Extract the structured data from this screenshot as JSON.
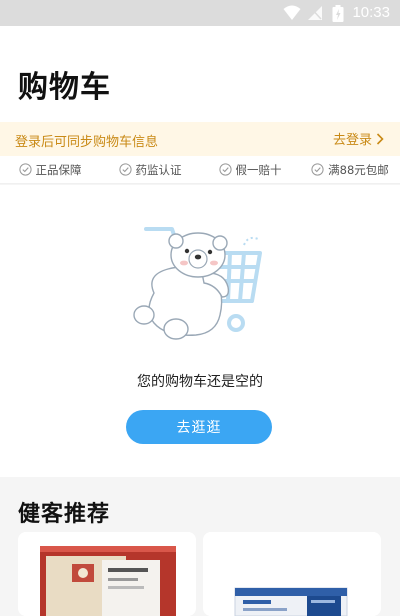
{
  "status_bar": {
    "time": "10:33"
  },
  "header": {
    "title": "购物车"
  },
  "login_banner": {
    "message": "登录后可同步购物车信息",
    "action": "去登录"
  },
  "badges": [
    {
      "label": "正品保障"
    },
    {
      "label": "药监认证"
    },
    {
      "label": "假一赔十"
    },
    {
      "label": "满88元包邮"
    }
  ],
  "empty_cart": {
    "message": "您的购物车还是空的",
    "button": "去逛逛"
  },
  "recommend": {
    "title": "健客推荐"
  }
}
